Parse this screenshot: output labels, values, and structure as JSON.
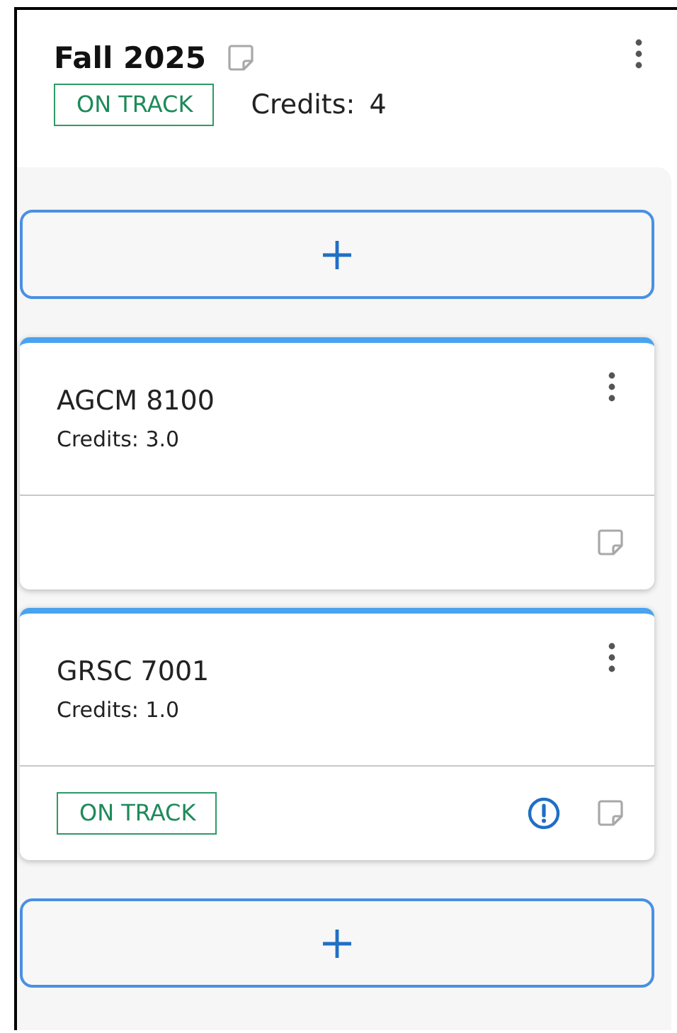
{
  "term": {
    "title": "Fall 2025",
    "status": "ON TRACK",
    "credits_label": "Credits:",
    "credits": "4"
  },
  "courses": [
    {
      "code": "AGCM 8100",
      "credits": "Credits: 3.0",
      "alert": false
    },
    {
      "code": "GRSC 7001",
      "credits": "Credits: 1.0",
      "status": "ON TRACK",
      "alert": true
    }
  ]
}
